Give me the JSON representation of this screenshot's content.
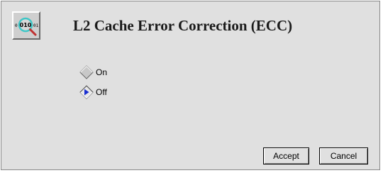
{
  "dialog": {
    "title": "L2 Cache Error Correction (ECC)",
    "icon": "binary-magnifier-icon",
    "icon_text": "010",
    "options": [
      {
        "label": "On",
        "selected": false
      },
      {
        "label": "Off",
        "selected": true
      }
    ],
    "buttons": {
      "accept_label": "Accept",
      "cancel_label": "Cancel"
    }
  },
  "colors": {
    "background": "#e0e0e0",
    "radio_selected": "#1a2fd0",
    "icon_lens": "#3fc7c7"
  }
}
